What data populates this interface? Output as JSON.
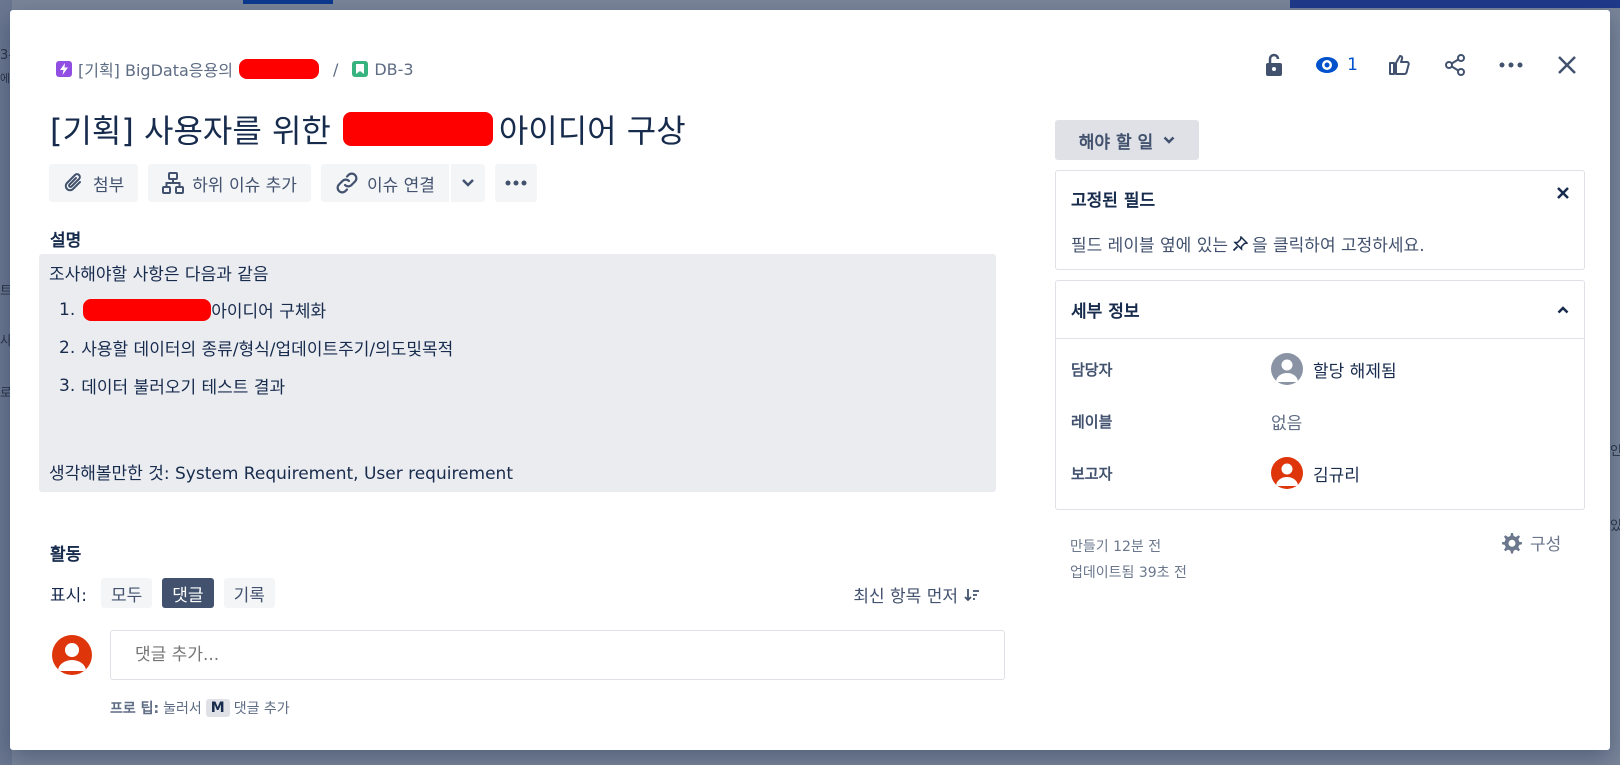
{
  "background": {
    "fragments": [
      "3-",
      "에",
      "트",
      "사",
      "로",
      "인",
      "있"
    ]
  },
  "breadcrumb": {
    "epic_label": "[기획] BigData응용의",
    "separator": "/",
    "issue_key": "DB-3"
  },
  "header": {
    "watch_count": "1"
  },
  "issue": {
    "title_prefix": "[기획] 사용자를 위한",
    "title_suffix": "아이디어 구상"
  },
  "toolbar": {
    "attach_label": "첨부",
    "add_child_label": "하위 이슈 추가",
    "link_issue_label": "이슈 연결"
  },
  "description": {
    "label": "설명",
    "intro": "조사해야할 사항은 다음과 같음",
    "items": [
      {
        "num": "1.",
        "text": "아이디어 구체화"
      },
      {
        "num": "2.",
        "text": "사용할 데이터의 종류/형식/업데이트주기/의도및목적"
      },
      {
        "num": "3.",
        "text": "데이터 불러오기 테스트 결과"
      }
    ],
    "footer": "생각해볼만한 것: System Requirement, User requirement"
  },
  "activity": {
    "label": "활동",
    "show_label": "표시:",
    "filters": [
      "모두",
      "댓글",
      "기록"
    ],
    "active_filter": "댓글",
    "sort_label": "최신 항목 먼저",
    "comment_placeholder": "댓글 추가...",
    "protip_prefix": "프로 팁:",
    "protip_mid": "눌러서",
    "protip_key": "M",
    "protip_suffix": "댓글 추가"
  },
  "sidebar": {
    "status_label": "해야 할 일",
    "pinned_title": "고정된 필드",
    "pinned_text_before": "필드 레이블 옆에 있는",
    "pinned_text_after": "을 클릭하여 고정하세요.",
    "details_title": "세부 정보",
    "assignee_label": "담당자",
    "assignee_value": "할당 해제됨",
    "labels_label": "레이블",
    "labels_value": "없음",
    "reporter_label": "보고자",
    "reporter_value": "김규리",
    "created": "만들기 12분 전",
    "updated": "업데이트됨 39초 전",
    "configure_label": "구성"
  },
  "colors": {
    "redaction": "#ff0000",
    "active_filter_bg": "#42526e",
    "watch_blue": "#0052cc",
    "avatar_red": "#de350b"
  }
}
